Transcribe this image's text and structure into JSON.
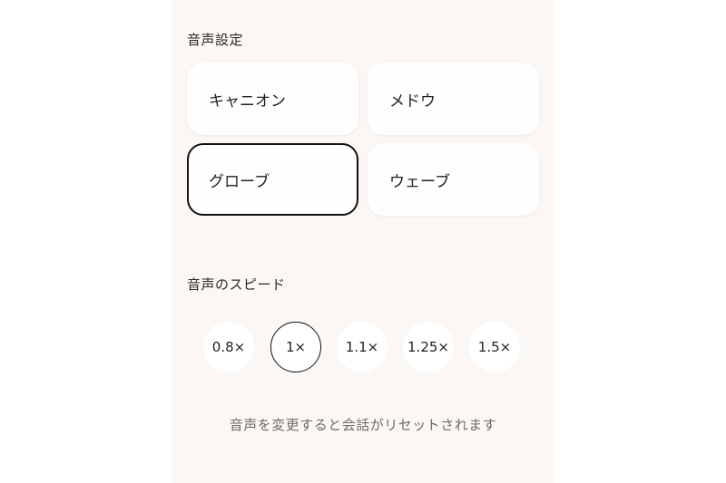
{
  "voice_section": {
    "title": "音声設定",
    "options": [
      {
        "label": "キャニオン",
        "selected": false
      },
      {
        "label": "メドウ",
        "selected": false
      },
      {
        "label": "グローブ",
        "selected": true
      },
      {
        "label": "ウェーブ",
        "selected": false
      }
    ]
  },
  "speed_section": {
    "title": "音声のスピード",
    "options": [
      {
        "label": "0.8×",
        "selected": false
      },
      {
        "label": "1×",
        "selected": true
      },
      {
        "label": "1.1×",
        "selected": false
      },
      {
        "label": "1.25×",
        "selected": false
      },
      {
        "label": "1.5×",
        "selected": false
      }
    ]
  },
  "note": "音声を変更すると会話がリセットされます",
  "colors": {
    "panel_background": "#fbf7f4",
    "card_background": "#fefefe",
    "selected_border": "#111111",
    "note_text": "#6f6b68"
  }
}
